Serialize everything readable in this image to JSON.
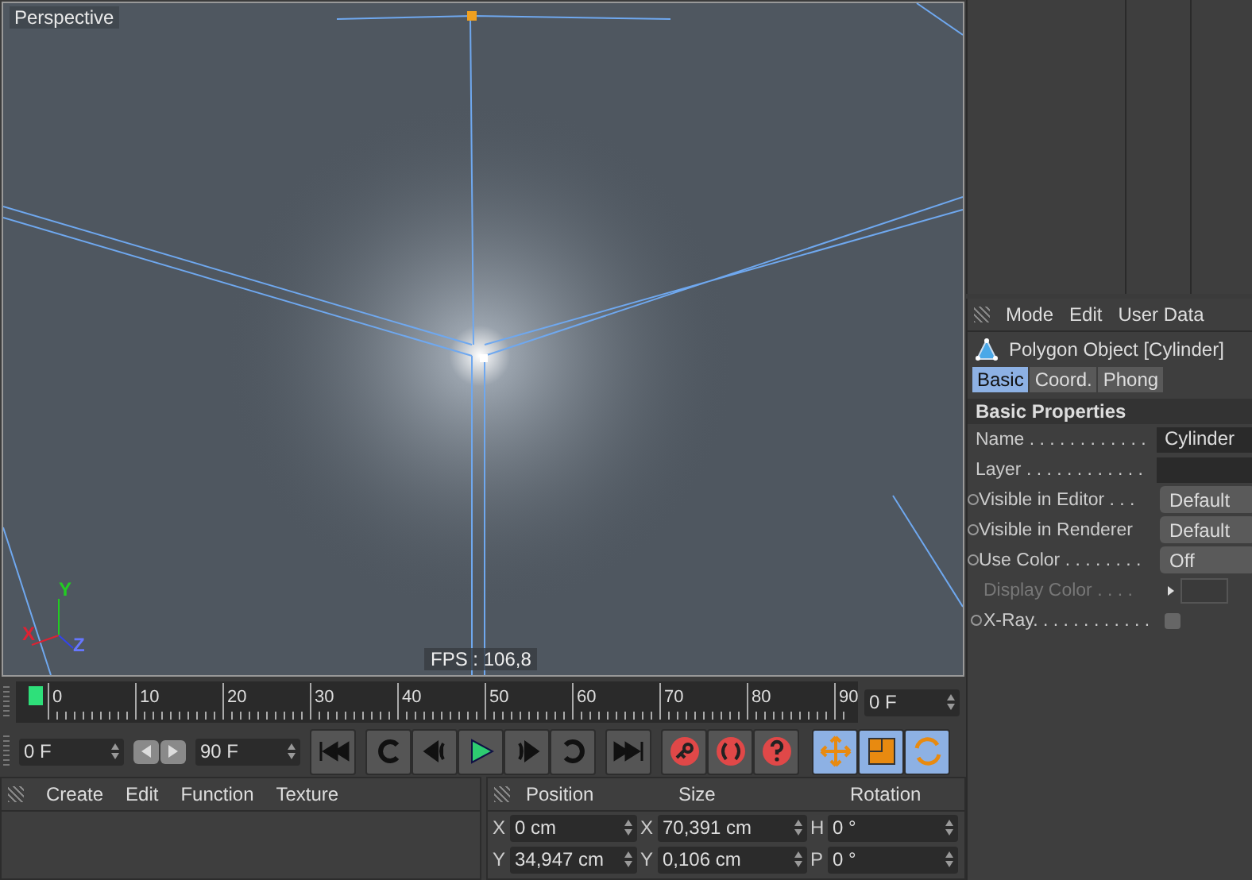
{
  "viewport": {
    "title": "Perspective",
    "fps": "FPS : 106,8",
    "axes": [
      {
        "label": "Y",
        "color": "#22cc22"
      },
      {
        "label": "X",
        "color": "#dd2233"
      },
      {
        "label": "Z",
        "color": "#6677ff"
      }
    ]
  },
  "timeline": {
    "ticks": [
      "0",
      "10",
      "20",
      "30",
      "40",
      "50",
      "60",
      "70",
      "80",
      "90"
    ],
    "current_frame": "0 F"
  },
  "transport": {
    "start": "0 F",
    "end": "90 F",
    "tools": [
      {
        "kind": "move",
        "selected": true
      },
      {
        "kind": "scale",
        "selected": true
      },
      {
        "kind": "rotate",
        "selected": true
      }
    ]
  },
  "material_menu": [
    "Create",
    "Edit",
    "Function",
    "Texture"
  ],
  "coordinates": {
    "headers": [
      "Position",
      "Size",
      "Rotation"
    ],
    "rows": [
      {
        "cells": [
          {
            "axis": "X",
            "value": "0 cm"
          },
          {
            "axis": "X",
            "value": "70,391 cm"
          },
          {
            "axis": "H",
            "value": "0 °"
          }
        ]
      },
      {
        "cells": [
          {
            "axis": "Y",
            "value": "34,947 cm"
          },
          {
            "axis": "Y",
            "value": "0,106 cm"
          },
          {
            "axis": "P",
            "value": "0 °"
          }
        ]
      }
    ]
  },
  "attributes": {
    "menu": [
      "Mode",
      "Edit",
      "User Data"
    ],
    "object_title": "Polygon Object [Cylinder]",
    "tabs": [
      {
        "label": "Basic",
        "selected": true
      },
      {
        "label": "Coord.",
        "selected": false
      },
      {
        "label": "Phong",
        "selected": false
      }
    ],
    "section": "Basic Properties",
    "rows": [
      {
        "kind": "text",
        "label": "Name . . . . . . . . . . . .",
        "value": "Cylinder",
        "animatable": false,
        "disabled": false
      },
      {
        "kind": "text",
        "label": "Layer . . . . . . . . . . . .",
        "value": "",
        "animatable": false,
        "disabled": false
      },
      {
        "kind": "dropdown",
        "label": "Visible in Editor . . .",
        "value": "Default",
        "animatable": true,
        "disabled": false
      },
      {
        "kind": "dropdown",
        "label": "Visible in Renderer",
        "value": "Default",
        "animatable": true,
        "disabled": false
      },
      {
        "kind": "dropdown",
        "label": "Use Color . . . . . . . .",
        "value": "Off",
        "animatable": true,
        "disabled": false
      },
      {
        "kind": "color",
        "label": "Display Color . . . .",
        "value": "",
        "animatable": false,
        "disabled": true
      },
      {
        "kind": "checkbox",
        "label": "X-Ray. . . . . . . . . . . .",
        "value": "",
        "animatable": true,
        "disabled": false,
        "checked": false
      }
    ]
  }
}
